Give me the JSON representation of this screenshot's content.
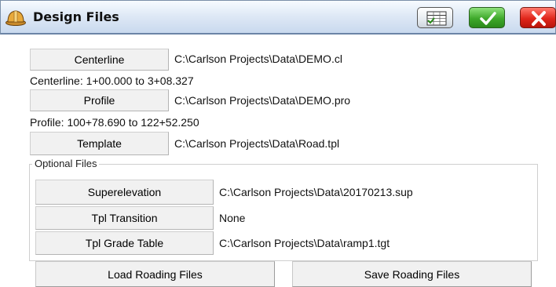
{
  "window": {
    "title": "Design Files",
    "icon": "hardhat-icon",
    "buttons": {
      "grid": "spreadsheet-icon",
      "ok": "checkmark-icon",
      "cancel": "close-icon"
    }
  },
  "files": {
    "centerline": {
      "label": "Centerline",
      "path": "C:\\Carlson Projects\\Data\\DEMO.cl",
      "info": "Centerline: 1+00.000 to 3+08.327"
    },
    "profile": {
      "label": "Profile",
      "path": "C:\\Carlson Projects\\Data\\DEMO.pro",
      "info": "Profile: 100+78.690 to 122+52.250"
    },
    "template": {
      "label": "Template",
      "path": "C:\\Carlson Projects\\Data\\Road.tpl"
    }
  },
  "optional": {
    "label": "Optional Files",
    "superelevation": {
      "label": "Superelevation",
      "path": "C:\\Carlson Projects\\Data\\20170213.sup"
    },
    "tpl_transition": {
      "label": "Tpl Transition",
      "path": "None"
    },
    "tpl_grade_table": {
      "label": "Tpl Grade Table",
      "path": "C:\\Carlson Projects\\Data\\ramp1.tgt"
    }
  },
  "actions": {
    "load": "Load Roading Files",
    "save": "Save Roading Files"
  },
  "colors": {
    "ok_green": "#3ea82a",
    "cancel_red": "#e0261a",
    "titlebar": "#dfe9f6"
  }
}
